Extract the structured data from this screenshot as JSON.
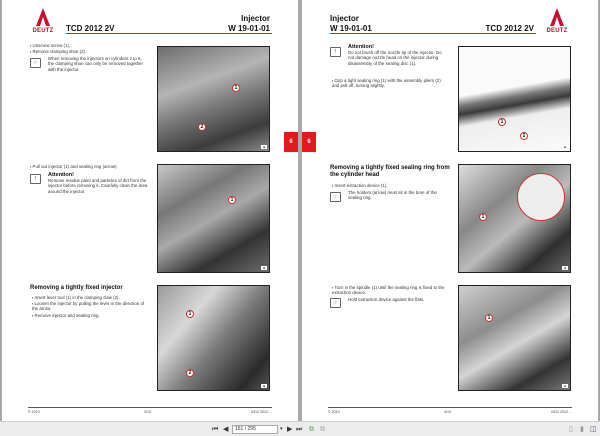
{
  "left_page": {
    "logo": "DEUTZ",
    "model": "TCD 2012 2V",
    "title": "Injector",
    "code": "W 19-01-01",
    "s1": {
      "bullets": [
        "Unscrew screw (1).",
        "Remove clamping shoe (2)."
      ],
      "note": "When removing the injectors on cylinders 2 to 6, the clamping shoe can only be removed together with the injector.",
      "callouts": [
        "1",
        "2"
      ]
    },
    "s2": {
      "bullets": [
        "Pull out injector (1) and sealing ring (arrow)."
      ],
      "attention_title": "Attention!",
      "attention": "Remove residue paint and particles of dirt from the injector before removing it. Carefully clean the area around the injector.",
      "callouts": [
        "1"
      ]
    },
    "s3": {
      "heading": "Removing a tightly fixed injector",
      "bullets": [
        "Insert lever tool (1) in the clamping claw (2).",
        "Loosen the injector by pulling the lever in the direction of the arrow.",
        "Remove injector and sealing ring."
      ],
      "callouts": [
        "1",
        "2"
      ]
    },
    "tab": "6",
    "footer": {
      "left": "© 2010",
      "center": "3/10",
      "right": "0312 2012 ..."
    }
  },
  "right_page": {
    "logo": "DEUTZ",
    "model": "TCD 2012 2V",
    "title": "Injector",
    "code": "W 19-01-01",
    "s1": {
      "attention_title": "Attention!",
      "attention": "Do not brush off the nozzle tip of the injector. Do not damage nozzle head on the injector during disassembly of the sealing disc (1).",
      "bullets": [
        "Grip a tight sealing ring (1) with the assembly pliers (2) and pull off, turning slightly."
      ],
      "callouts": [
        "1",
        "2"
      ]
    },
    "s2": {
      "heading": "Removing a tightly fixed sealing ring from the cylinder head",
      "bullets": [
        "Insert extraction device (1)."
      ],
      "note": "The holders (arrow) must sit in the bore of the sealing ring.",
      "callouts": [
        "1"
      ]
    },
    "s3": {
      "bullets": [
        "Turn in the spindle (1) until the sealing ring is fixed to the extraction device."
      ],
      "note": "Hold extraction device against the flats.",
      "callouts": [
        "1"
      ]
    },
    "tab": "6",
    "footer": {
      "left": "© 2010",
      "center": "4/10",
      "right": "0312 2012 ..."
    }
  },
  "toolbar": {
    "page_field": "151 / 295"
  }
}
